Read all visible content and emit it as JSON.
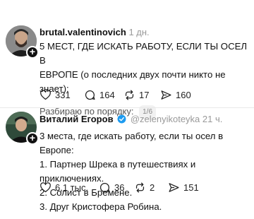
{
  "post1": {
    "username": "brutal.valentinovich",
    "time": "1 дн.",
    "text_line1": "5 МЕСТ, ГДЕ ИСКАТЬ РАБОТУ, ЕСЛИ ТЫ ОСЕЛ В",
    "text_line2": "ЕВРОПЕ (о последних двух почти никто не знает):",
    "subtext": "Разбираю по порядку:",
    "thread_counter": "1/6",
    "likes": "331",
    "comments": "164",
    "reposts": "17",
    "shares": "160"
  },
  "post2": {
    "username": "Виталий Егоров",
    "handle": "@zelenyikoteyka",
    "time": "21 ч.",
    "lines": [
      "3 места, где искать работу, если ты осел в Европе:",
      "1. Партнер Шрека в путешествиях и приключениях.",
      "2. Солист в Бремене.",
      "3. Друг Кристофера Робина."
    ],
    "likes": "6,1 тыс.",
    "comments": "36",
    "reposts": "2",
    "shares": "151"
  },
  "colors": {
    "verified": "#1d9bf0",
    "muted": "#999999"
  },
  "icons": {
    "like": "heart-icon",
    "comment": "comment-bubble-icon",
    "repost": "repost-icon",
    "share": "send-icon",
    "follow": "plus-icon",
    "verified": "verified-badge-icon"
  }
}
